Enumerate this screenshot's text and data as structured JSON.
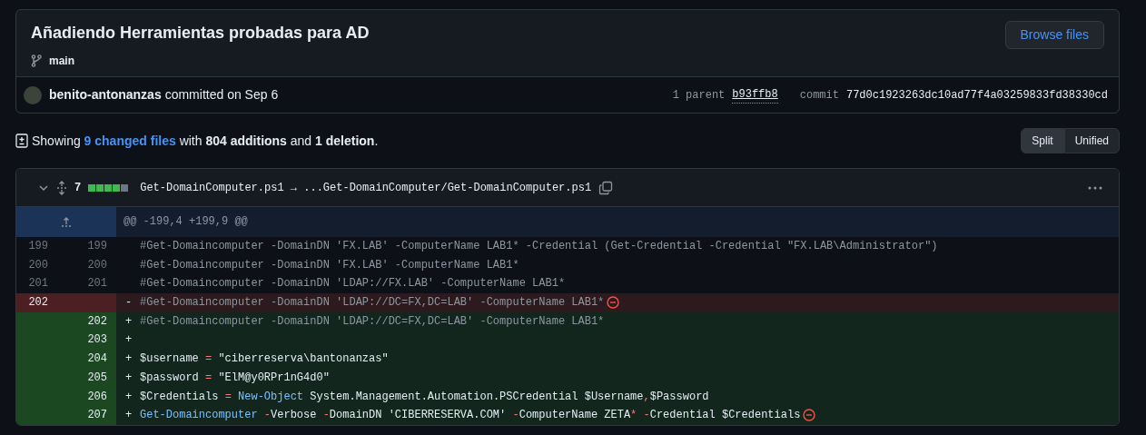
{
  "commit": {
    "title": "Añadiendo Herramientas probadas para AD",
    "browse_button": "Browse files",
    "branch": "main",
    "author": "benito-antonanzas",
    "action": "committed on Sep 6",
    "parent_label": "1 parent",
    "parent_sha": "b93ffb8",
    "commit_label": "commit",
    "commit_sha": "77d0c1923263dc10ad77f4a03259833fd38330cd"
  },
  "summary": [
    {
      "kind": "text",
      "text": "Showing "
    },
    {
      "kind": "link",
      "text": "9 changed files"
    },
    {
      "kind": "text",
      "text": " with **804 additions** and **1 deletion**."
    }
  ],
  "view_toggle": [
    {
      "label": "Split",
      "selected": true
    },
    {
      "label": "Unified",
      "selected": false
    }
  ],
  "file": {
    "expanded": true,
    "changes": "7",
    "diffstat": [
      {
        "kind": "added"
      },
      {
        "kind": "added"
      },
      {
        "kind": "added"
      },
      {
        "kind": "added"
      },
      {
        "kind": "neutral"
      }
    ],
    "path": "Get-DomainComputer.ps1 → ...Get-DomainComputer/Get-DomainComputer.ps1",
    "hunk": "@@ -199,4 +199,9 @@",
    "lines": [
      {
        "kind": "context",
        "old": "199",
        "new": "199",
        "tokens": [
          {
            "kind": "comment",
            "text": "#Get-Domaincomputer -DomainDN 'FX.LAB' -ComputerName LAB1* -Credential (Get-Credential -Credential \"FX.LAB\\Administrator\")"
          }
        ]
      },
      {
        "kind": "context",
        "old": "200",
        "new": "200",
        "tokens": [
          {
            "kind": "comment",
            "text": "#Get-Domaincomputer -DomainDN 'FX.LAB' -ComputerName LAB1*"
          }
        ]
      },
      {
        "kind": "context",
        "old": "201",
        "new": "201",
        "tokens": [
          {
            "kind": "comment",
            "text": "#Get-Domaincomputer -DomainDN 'LDAP://FX.LAB' -ComputerName LAB1*"
          }
        ]
      },
      {
        "kind": "deletion",
        "old": "202",
        "sign": "-",
        "no_newline": true,
        "tokens": [
          {
            "kind": "comment",
            "text": "#Get-Domaincomputer -DomainDN 'LDAP://DC=FX,DC=LAB' -ComputerName LAB1*"
          }
        ]
      },
      {
        "kind": "addition",
        "new": "202",
        "sign": "+",
        "tokens": [
          {
            "kind": "comment",
            "text": "#Get-Domaincomputer -DomainDN 'LDAP://DC=FX,DC=LAB' -ComputerName LAB1*"
          }
        ]
      },
      {
        "kind": "addition",
        "new": "203",
        "sign": "+"
      },
      {
        "kind": "addition",
        "new": "204",
        "sign": "+",
        "tokens": [
          {
            "kind": "plain",
            "text": "$username "
          },
          {
            "kind": "operator",
            "text": "="
          },
          {
            "kind": "plain",
            "text": " \"ciberreserva\\bantonanzas\""
          }
        ]
      },
      {
        "kind": "addition",
        "new": "205",
        "sign": "+",
        "tokens": [
          {
            "kind": "plain",
            "text": "$password "
          },
          {
            "kind": "operator",
            "text": "="
          },
          {
            "kind": "plain",
            "text": " \"ElM@y0RPr1nG4d0\""
          }
        ]
      },
      {
        "kind": "addition",
        "new": "206",
        "sign": "+",
        "tokens": [
          {
            "kind": "plain",
            "text": "$Credentials "
          },
          {
            "kind": "operator",
            "text": "="
          },
          {
            "kind": "keyword",
            "text": " New-Object"
          },
          {
            "kind": "plain",
            "text": " System.Management.Automation.PSCredential $Username"
          },
          {
            "kind": "operator",
            "text": ","
          },
          {
            "kind": "plain",
            "text": "$Password"
          }
        ]
      },
      {
        "kind": "addition",
        "new": "207",
        "sign": "+",
        "no_newline": true,
        "tokens": [
          {
            "kind": "keyword",
            "text": "Get-Domaincomputer"
          },
          {
            "kind": "operator",
            "text": " -"
          },
          {
            "kind": "plain",
            "text": "Verbose "
          },
          {
            "kind": "operator",
            "text": "-"
          },
          {
            "kind": "plain",
            "text": "DomainDN 'CIBERRESERVA.COM' "
          },
          {
            "kind": "operator",
            "text": "-"
          },
          {
            "kind": "plain",
            "text": "ComputerName ZETA"
          },
          {
            "kind": "operator",
            "text": "*"
          },
          {
            "kind": "operator",
            "text": " -"
          },
          {
            "kind": "plain",
            "text": "Credential $Credentials"
          }
        ]
      }
    ]
  }
}
